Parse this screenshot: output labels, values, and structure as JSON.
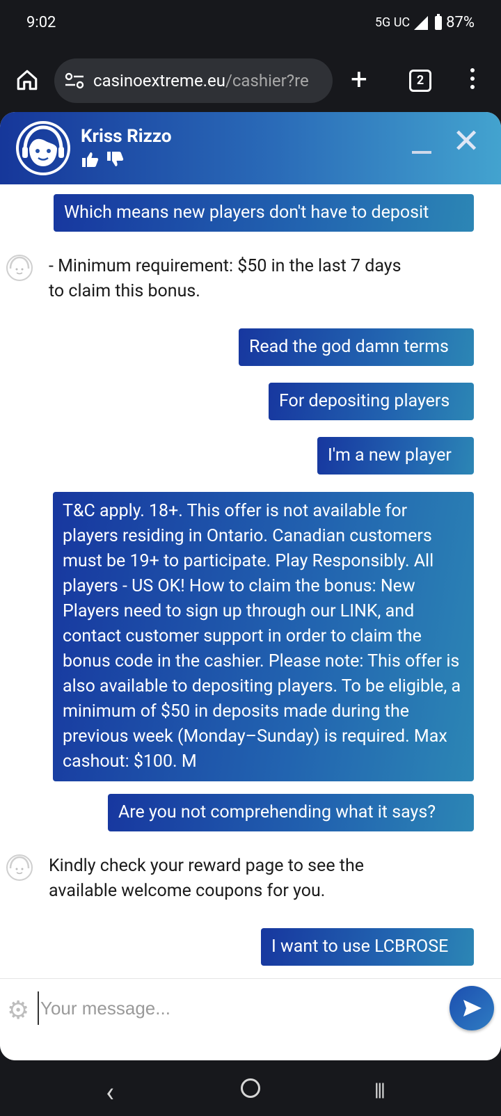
{
  "status": {
    "time": "9:02",
    "network": "5G UC",
    "battery": "87%"
  },
  "browser": {
    "url_domain": "casinoextreme.eu",
    "url_path": "/cashier?re",
    "tab_count": "2"
  },
  "chat": {
    "agent_name": "Kriss Rizzo",
    "messages": [
      {
        "from": "user",
        "text": "Which means new players don't have to deposit"
      },
      {
        "from": "agent",
        "text": "- Minimum requirement: $50 in the last 7 days to claim this bonus."
      },
      {
        "from": "user",
        "text": "Read the god damn terms"
      },
      {
        "from": "user",
        "text": "For depositing players"
      },
      {
        "from": "user",
        "text": "I'm a new player"
      },
      {
        "from": "user",
        "text": "T&C apply. 18+. This offer is not available for players residing in Ontario. Canadian customers must be 19+ to participate. Play Responsibly. All players - US OK! How to claim the bonus: New Players need to sign up through our LINK, and contact customer support in order to claim the bonus code in the cashier. Please note: This offer is also available to depositing players. To be eligible, a minimum of $50 in deposits made during the previous week (Monday–Sunday) is required. Max cashout: $100. M"
      },
      {
        "from": "user",
        "text": "Are you not comprehending what it says?"
      },
      {
        "from": "agent",
        "text": "Kindly check your reward page to see the available welcome coupons for you."
      },
      {
        "from": "user",
        "text": "I want to use LCBROSE"
      }
    ],
    "input_placeholder": "Your message..."
  }
}
